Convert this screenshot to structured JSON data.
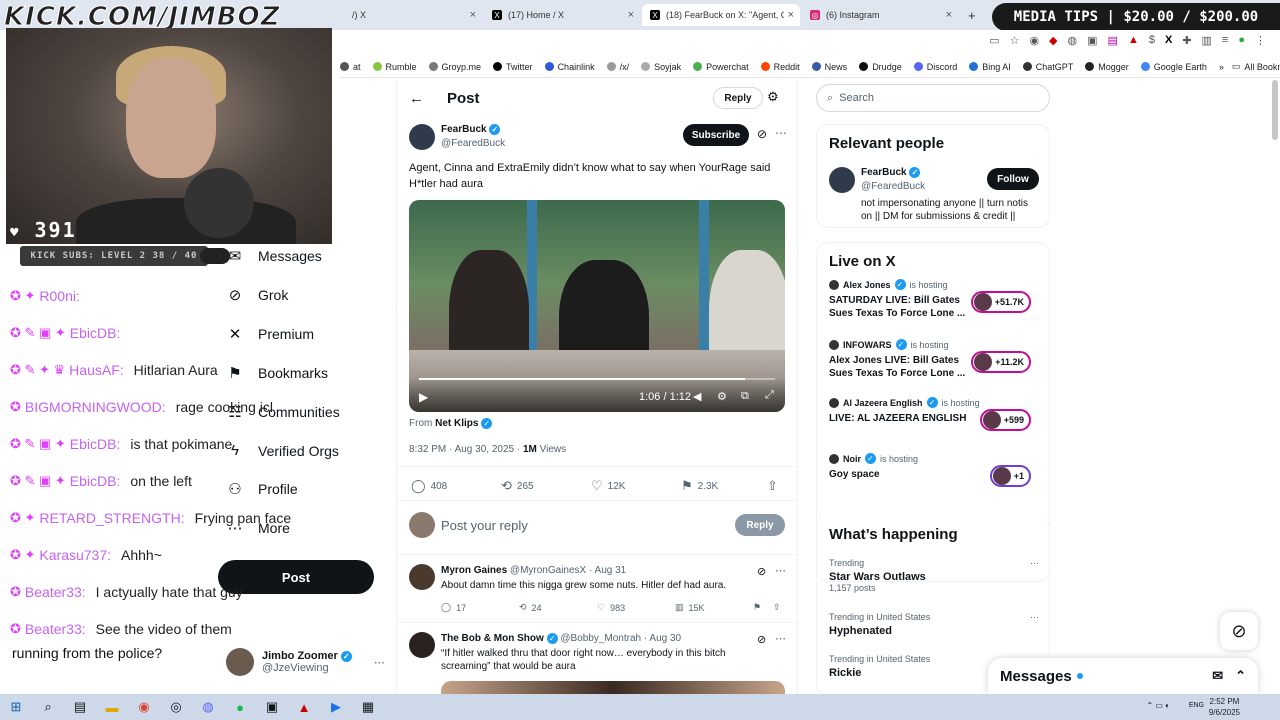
{
  "stream": {
    "watermark": "KICK.COM/JIMBOZ",
    "viewers": "391",
    "kick_subs": "KICK SUBS: LEVEL 2 38 / 40",
    "media_tips": "MEDIA TIPS | $20.00 / $200.00"
  },
  "chat": [
    {
      "user": "R00ni:",
      "msg": "",
      "badges": "✪ ✦"
    },
    {
      "user": "EbicDB:",
      "msg": "",
      "badges": "✪ ✎ ▣ ✦"
    },
    {
      "user": "HausAF:",
      "msg": "Hitlarian Aura",
      "badges": "✪ ✎ ✦ ♛"
    },
    {
      "user": "BIGMORNINGWOOD:",
      "msg": "rage cooking icl",
      "badges": "✪"
    },
    {
      "user": "EbicDB:",
      "msg": "is that pokimane",
      "badges": "✪ ✎ ▣ ✦"
    },
    {
      "user": "EbicDB:",
      "msg": "on the left",
      "badges": "✪ ✎ ▣ ✦"
    },
    {
      "user": "RETARD_STRENGTH:",
      "msg": "Frying pan face",
      "badges": "✪ ✦"
    },
    {
      "user": "Karasu737:",
      "msg": "Ahhh~",
      "badges": "✪ ✦"
    },
    {
      "user": "Beater33:",
      "msg": "I actyually hate that guy",
      "badges": "✪"
    },
    {
      "user": "Beater33:",
      "msg": "See the video of them",
      "badges": "✪"
    }
  ],
  "chat_continuation": "running from the police?",
  "browser": {
    "tabs": [
      {
        "label": "/) X"
      },
      {
        "label": "(17) Home / X"
      },
      {
        "label": "(18) FearBuck on X: \"Agent, Cinn"
      },
      {
        "label": "(6) Instagram"
      }
    ],
    "new_tab": "+",
    "bookmarks": [
      {
        "label": "at",
        "color": "#555"
      },
      {
        "label": "Rumble",
        "color": "#85c742"
      },
      {
        "label": "Groyp.me",
        "color": "#777"
      },
      {
        "label": "Twitter",
        "color": "#000"
      },
      {
        "label": "Chainlink",
        "color": "#2a5ada"
      },
      {
        "label": "/x/",
        "color": "#999"
      },
      {
        "label": "Soyjak",
        "color": "#aaa"
      },
      {
        "label": "Powerchat",
        "color": "#4caf50"
      },
      {
        "label": "Reddit",
        "color": "#ff4500"
      },
      {
        "label": "News",
        "color": "#3a5aa8"
      },
      {
        "label": "Drudge",
        "color": "#111"
      },
      {
        "label": "Discord",
        "color": "#5865f2"
      },
      {
        "label": "Bing AI",
        "color": "#2270d4"
      },
      {
        "label": "ChatGPT",
        "color": "#333"
      },
      {
        "label": "Mogger",
        "color": "#222"
      },
      {
        "label": "Google Earth",
        "color": "#4285f4"
      }
    ],
    "all_bookmarks": "All Bookmarks"
  },
  "nav": {
    "messages": "Messages",
    "grok": "Grok",
    "premium": "Premium",
    "bookmarks": "Bookmarks",
    "communities": "Communities",
    "verified_orgs": "Verified Orgs",
    "profile": "Profile",
    "more": "More",
    "post": "Post",
    "me_name": "Jimbo Zoomer",
    "me_handle": "@JzeViewing"
  },
  "post": {
    "header": "Post",
    "reply_btn": "Reply",
    "author": "FearBuck",
    "handle": "@FearedBuck",
    "subscribe": "Subscribe",
    "text": "Agent, Cinna and ExtraEmily didn’t know what to say when YourRage said H*tler had aura",
    "video_time": "1:06 / 1:12",
    "video_progress": 0.917,
    "from_label": "From",
    "from_source": "Net Klips",
    "timestamp": "8:32 PM · Aug 30, 2025 ·",
    "views_count": "1M",
    "views_label": "Views",
    "replies": "408",
    "reposts": "265",
    "likes": "12K",
    "bookmarks": "2.3K",
    "reply_placeholder": "Post your reply",
    "reply_submit": "Reply"
  },
  "replies": [
    {
      "name": "Myron Gaines",
      "handle": "@MyronGainesX · Aug 31",
      "text": "About damn time this nigga grew some nuts. Hitler def had aura.",
      "replies": "17",
      "reposts": "24",
      "likes": "983",
      "views": "15K"
    },
    {
      "name": "The Bob & Mon Show",
      "handle": "@Bobby_Montrah · Aug 30",
      "text": "“If hitler walked thru that door right now… everybody in this bitch screaming” that would be aura"
    }
  ],
  "right": {
    "search_placeholder": "Search",
    "relevant_title": "Relevant people",
    "rp_name": "FearBuck",
    "rp_handle": "@FearedBuck",
    "rp_follow": "Follow",
    "rp_bio": "not impersonating anyone || turn notis on || DM for submissions & credit ||",
    "live_title": "Live on X",
    "live": [
      {
        "host": "Alex Jones",
        "status": "is hosting",
        "title": "SATURDAY LIVE: Bill Gates Sues Texas To Force Lone ...",
        "count": "+51.7K"
      },
      {
        "host": "INFOWARS",
        "status": "is hosting",
        "title": "Alex Jones LIVE: Bill Gates Sues Texas To Force Lone ...",
        "count": "+11.2K"
      },
      {
        "host": "Al Jazeera English",
        "status": "is hosting",
        "title": "LIVE: AL JAZEERA ENGLISH",
        "count": "+599"
      },
      {
        "host": "Noir",
        "status": "is hosting",
        "title": "Goy space",
        "count": "+1"
      }
    ],
    "happening_title": "What’s happening",
    "trends": [
      {
        "context": "Trending",
        "name": "Star Wars Outlaws",
        "posts": "1,157 posts"
      },
      {
        "context": "Trending in United States",
        "name": "Hyphenated",
        "posts": ""
      },
      {
        "context": "Trending in United States",
        "name": "Rickie",
        "posts": ""
      }
    ]
  },
  "messages_drawer": "Messages",
  "taskbar": {
    "lang": "ENG",
    "time": "2:52 PM",
    "date": "9/6/2025"
  }
}
